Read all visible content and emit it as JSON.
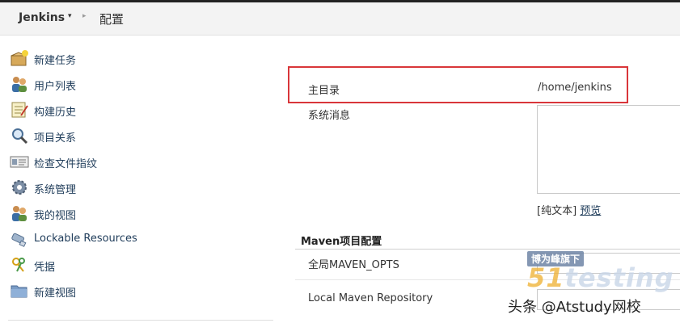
{
  "breadcrumb": {
    "home": "Jenkins",
    "caret": "▾",
    "separator": "▸",
    "page": "配置"
  },
  "sidebar": {
    "items": [
      {
        "label": "新建任务",
        "icon": "new-item-icon"
      },
      {
        "label": "用户列表",
        "icon": "people-icon"
      },
      {
        "label": "构建历史",
        "icon": "notepad-icon"
      },
      {
        "label": "项目关系",
        "icon": "magnifier-icon"
      },
      {
        "label": "检查文件指纹",
        "icon": "fingerprint-icon"
      },
      {
        "label": "系统管理",
        "icon": "gear-icon"
      },
      {
        "label": "我的视图",
        "icon": "user-icon"
      },
      {
        "label": "Lockable Resources",
        "icon": "usb-icon"
      },
      {
        "label": "凭据",
        "icon": "keys-icon"
      },
      {
        "label": "新建视图",
        "icon": "folder-icon"
      }
    ]
  },
  "main": {
    "home_dir_label": "主目录",
    "home_dir_value": "/home/jenkins",
    "system_message_label": "系统消息",
    "plain_text": "[纯文本]",
    "preview_link": "预览",
    "maven_section_title": "Maven项目配置",
    "maven_opts_label": "全局MAVEN_OPTS",
    "local_repo_label": "Local Maven Repository"
  },
  "watermark": {
    "tag": "博为峰旗下",
    "brand_num": "51",
    "brand_text": "testing",
    "credit": "头条 @Atstudy网校"
  },
  "colors": {
    "highlight": "#d9363a",
    "link": "#1f3c5a"
  }
}
